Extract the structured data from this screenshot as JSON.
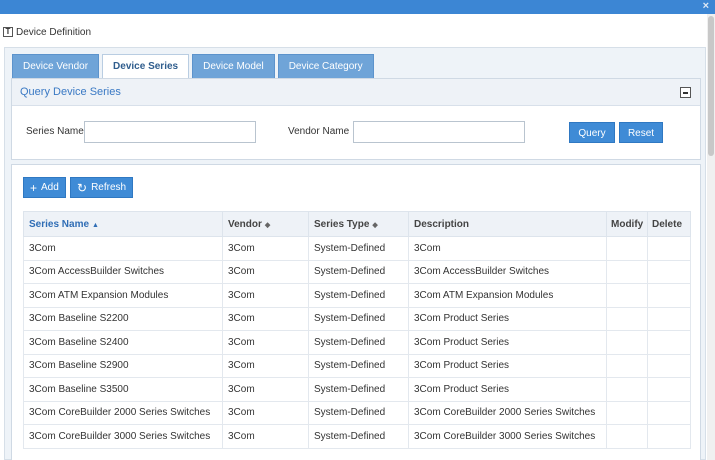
{
  "dialog": {
    "title": "Device Definition",
    "close_label": "×"
  },
  "tabs": [
    {
      "label": "Device Vendor",
      "active": false
    },
    {
      "label": "Device Series",
      "active": true
    },
    {
      "label": "Device Model",
      "active": false
    },
    {
      "label": "Device Category",
      "active": false
    }
  ],
  "query": {
    "title": "Query Device Series",
    "series_name_label": "Series Name",
    "series_name_value": "",
    "vendor_name_label": "Vendor Name",
    "vendor_name_value": "",
    "query_button": "Query",
    "reset_button": "Reset"
  },
  "toolbar": {
    "add_label": "Add",
    "refresh_label": "Refresh"
  },
  "table": {
    "headers": [
      "Series Name",
      "Vendor",
      "Series Type",
      "Description",
      "Modify",
      "Delete"
    ],
    "sorted_column": "Series Name",
    "rows": [
      [
        "3Com",
        "3Com",
        "System-Defined",
        "3Com"
      ],
      [
        "3Com AccessBuilder Switches",
        "3Com",
        "System-Defined",
        "3Com AccessBuilder Switches"
      ],
      [
        "3Com ATM Expansion Modules",
        "3Com",
        "System-Defined",
        "3Com ATM Expansion Modules"
      ],
      [
        "3Com Baseline S2200",
        "3Com",
        "System-Defined",
        "3Com Product Series"
      ],
      [
        "3Com Baseline S2400",
        "3Com",
        "System-Defined",
        "3Com Product Series"
      ],
      [
        "3Com Baseline S2900",
        "3Com",
        "System-Defined",
        "3Com Product Series"
      ],
      [
        "3Com Baseline S3500",
        "3Com",
        "System-Defined",
        "3Com Product Series"
      ],
      [
        "3Com CoreBuilder 2000 Series Switches",
        "3Com",
        "System-Defined",
        "3Com CoreBuilder 2000 Series Switches"
      ],
      [
        "3Com CoreBuilder 3000 Series Switches",
        "3Com",
        "System-Defined",
        "3Com CoreBuilder 3000 Series Switches"
      ]
    ]
  },
  "colors": {
    "accent": "#3f8bd6",
    "title_bar": "#3c86d4",
    "tab_inactive": "#6fa4d8",
    "link": "#3a79c4"
  }
}
